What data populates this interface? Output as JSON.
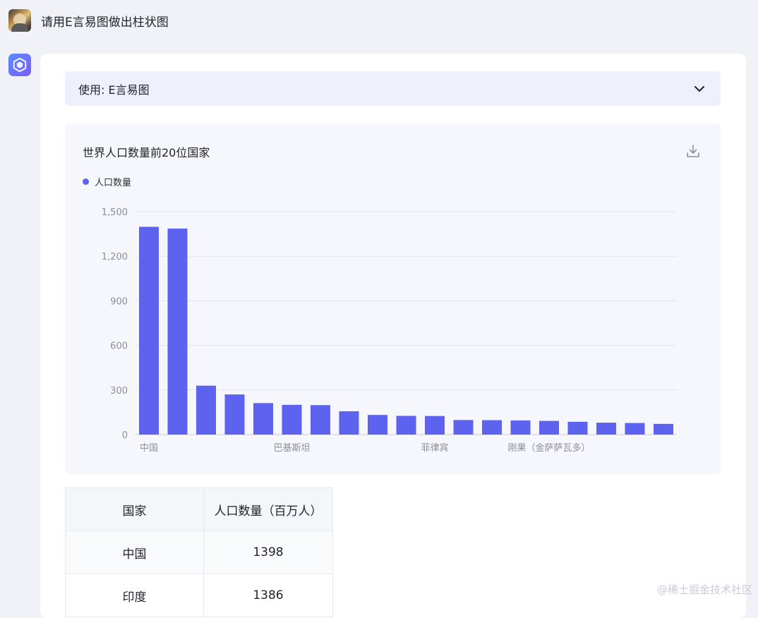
{
  "user": {
    "message": "请用E言易图做出柱状图"
  },
  "tool": {
    "label": "使用: E言易图"
  },
  "chart_data": {
    "type": "bar",
    "title": "世界人口数量前20位国家",
    "legend": "人口数量",
    "legend_position": "top-left",
    "grid": true,
    "color": "#5d63ee",
    "ylim": [
      0,
      1500
    ],
    "yticks": [
      "0",
      "300",
      "600",
      "900",
      "1,200",
      "1,500"
    ],
    "ytick_values": [
      0,
      300,
      600,
      900,
      1200,
      1500
    ],
    "shown_x_labels": [
      {
        "index": 0,
        "label": "中国"
      },
      {
        "index": 5,
        "label": "巴基斯坦"
      },
      {
        "index": 10,
        "label": "菲律宾"
      },
      {
        "index": 14,
        "label": "刚果（金萨萨瓦多）"
      }
    ],
    "series": [
      {
        "name": "人口数量",
        "values": [
          1398,
          1386,
          329,
          270,
          212,
          200,
          198,
          157,
          132,
          126,
          125,
          98,
          97,
          95,
          92,
          86,
          80,
          78,
          72
        ]
      }
    ]
  },
  "table": {
    "headers": [
      "国家",
      "人口数量（百万人）"
    ],
    "rows": [
      [
        "中国",
        "1398"
      ],
      [
        "印度",
        "1386"
      ]
    ]
  },
  "footer": {
    "brand": "@稀土掘金技术社区"
  }
}
